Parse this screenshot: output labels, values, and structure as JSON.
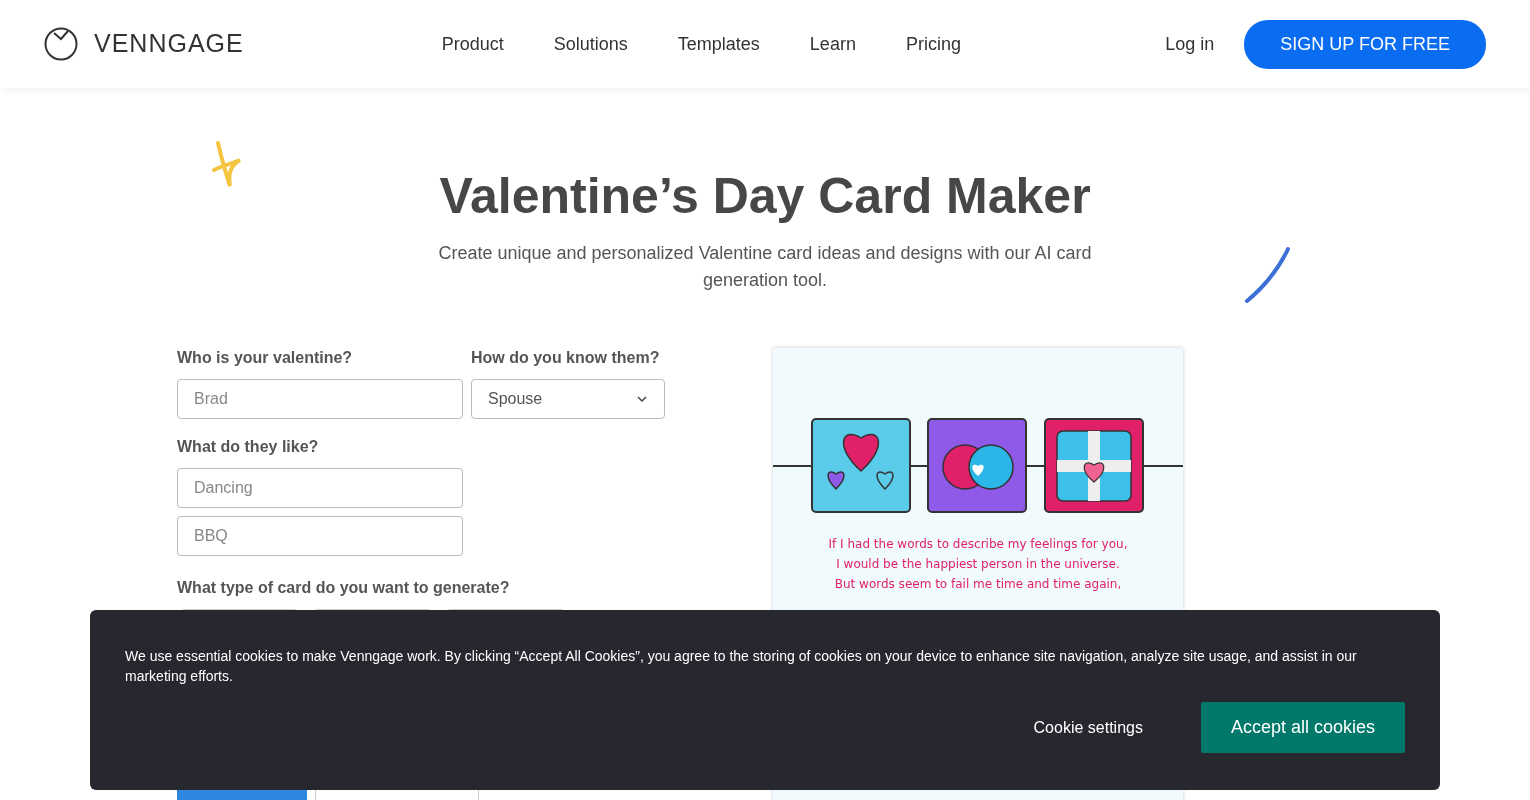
{
  "navbar": {
    "brand": "VENNGAGE",
    "links": [
      "Product",
      "Solutions",
      "Templates",
      "Learn",
      "Pricing"
    ],
    "login": "Log in",
    "signup": "SIGN UP FOR FREE"
  },
  "hero": {
    "title": "Valentine’s Day Card Maker",
    "subtitle": "Create unique and personalized Valentine card ideas and designs with our AI card generation tool."
  },
  "form": {
    "valentine_label": "Who is your valentine?",
    "valentine_placeholder": "Brad",
    "relation_label": "How do you know them?",
    "relation_value": "Spouse",
    "likes_label": "What do they like?",
    "likes_placeholders": [
      "Dancing",
      "BBQ"
    ],
    "card_type_label": "What type of card do you want to generate?",
    "buttons": [
      {
        "kind": "primary"
      },
      {
        "kind": "outline"
      }
    ]
  },
  "card_preview": {
    "verse": [
      "If I had the words to describe my feelings for you,",
      "I would be the happiest person in the universe.",
      "But words seem to fail me time and time again,"
    ]
  },
  "cookie_banner": {
    "text": "We use essential cookies to make Venngage work. By clicking “Accept All Cookies”, you agree to the storing of cookies on your device to enhance site navigation, analyze site usage, and assist in our marketing efforts.",
    "settings": "Cookie settings",
    "accept": "Accept all cookies"
  }
}
